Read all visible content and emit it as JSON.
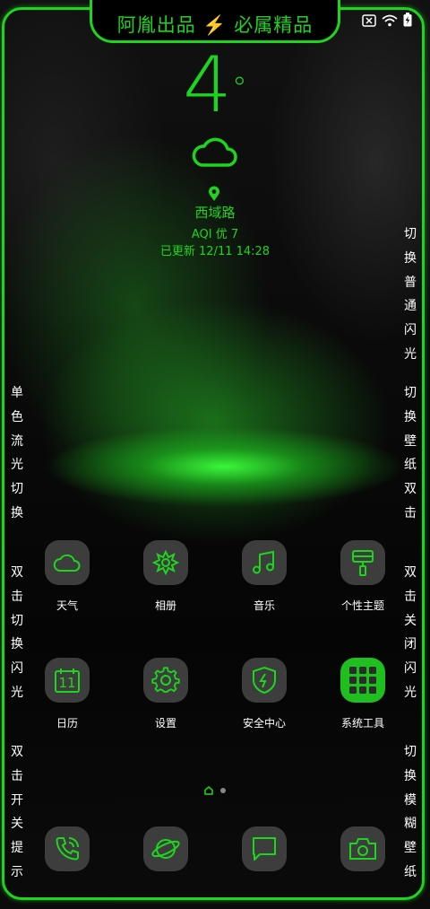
{
  "colors": {
    "accent": "#1ed51e",
    "icon_bg": "#3d3d3d"
  },
  "notch_title": "阿胤出品 ⚡ 必属精品",
  "status_bar": {
    "icons": [
      "sim-x-icon",
      "wifi-icon",
      "battery-charging-icon"
    ]
  },
  "weather": {
    "temperature": "4",
    "degree": "°",
    "condition_icon": "cloud-icon",
    "location": "西域路",
    "aqi": "AQI 优 7",
    "updated": "已更新 12/11 14:28"
  },
  "side_texts": {
    "right_1": "切换普通闪光",
    "right_2": "切换壁纸双击",
    "right_3": "双击关闭闪光",
    "right_4": "切换模糊壁纸",
    "left_1": "单色流光切换",
    "left_2": "双击切换闪光",
    "left_3": "双击开关提示"
  },
  "apps_row1": [
    {
      "label": "天气",
      "icon": "cloud-icon"
    },
    {
      "label": "相册",
      "icon": "flower-icon"
    },
    {
      "label": "音乐",
      "icon": "music-note-icon"
    },
    {
      "label": "个性主题",
      "icon": "paint-brush-icon"
    }
  ],
  "apps_row2": [
    {
      "label": "日历",
      "icon": "calendar-icon",
      "day": "11"
    },
    {
      "label": "设置",
      "icon": "gear-icon"
    },
    {
      "label": "安全中心",
      "icon": "shield-icon"
    },
    {
      "label": "系统工具",
      "icon": "tools-grid-icon"
    }
  ],
  "dock": [
    {
      "icon": "phone-icon"
    },
    {
      "icon": "browser-planet-icon"
    },
    {
      "icon": "message-icon"
    },
    {
      "icon": "camera-icon"
    }
  ],
  "page_indicator": {
    "pages": 2,
    "current": 1
  }
}
